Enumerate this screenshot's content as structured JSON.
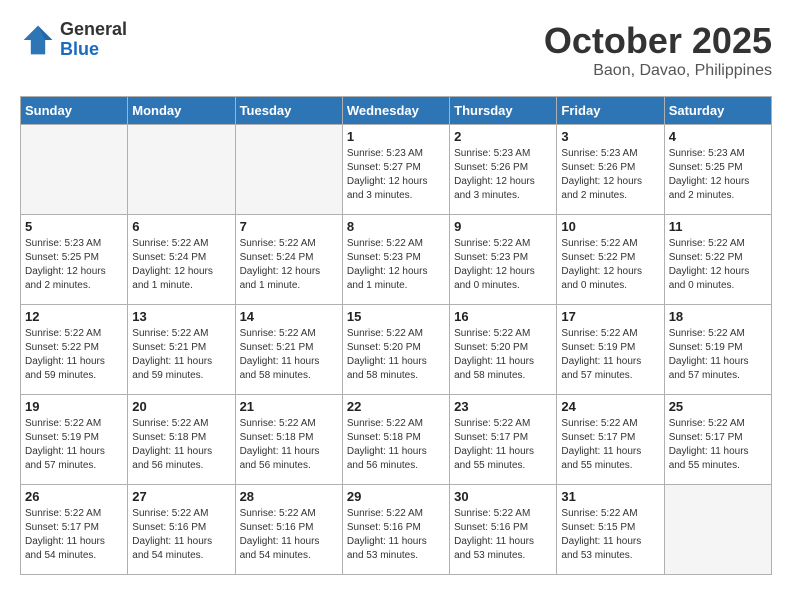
{
  "logo": {
    "general": "General",
    "blue": "Blue"
  },
  "title": "October 2025",
  "location": "Baon, Davao, Philippines",
  "weekdays": [
    "Sunday",
    "Monday",
    "Tuesday",
    "Wednesday",
    "Thursday",
    "Friday",
    "Saturday"
  ],
  "weeks": [
    [
      {
        "day": "",
        "empty": true
      },
      {
        "day": "",
        "empty": true
      },
      {
        "day": "",
        "empty": true
      },
      {
        "day": "1",
        "sunrise": "Sunrise: 5:23 AM",
        "sunset": "Sunset: 5:27 PM",
        "daylight": "Daylight: 12 hours and 3 minutes."
      },
      {
        "day": "2",
        "sunrise": "Sunrise: 5:23 AM",
        "sunset": "Sunset: 5:26 PM",
        "daylight": "Daylight: 12 hours and 3 minutes."
      },
      {
        "day": "3",
        "sunrise": "Sunrise: 5:23 AM",
        "sunset": "Sunset: 5:26 PM",
        "daylight": "Daylight: 12 hours and 2 minutes."
      },
      {
        "day": "4",
        "sunrise": "Sunrise: 5:23 AM",
        "sunset": "Sunset: 5:25 PM",
        "daylight": "Daylight: 12 hours and 2 minutes."
      }
    ],
    [
      {
        "day": "5",
        "sunrise": "Sunrise: 5:23 AM",
        "sunset": "Sunset: 5:25 PM",
        "daylight": "Daylight: 12 hours and 2 minutes."
      },
      {
        "day": "6",
        "sunrise": "Sunrise: 5:22 AM",
        "sunset": "Sunset: 5:24 PM",
        "daylight": "Daylight: 12 hours and 1 minute."
      },
      {
        "day": "7",
        "sunrise": "Sunrise: 5:22 AM",
        "sunset": "Sunset: 5:24 PM",
        "daylight": "Daylight: 12 hours and 1 minute."
      },
      {
        "day": "8",
        "sunrise": "Sunrise: 5:22 AM",
        "sunset": "Sunset: 5:23 PM",
        "daylight": "Daylight: 12 hours and 1 minute."
      },
      {
        "day": "9",
        "sunrise": "Sunrise: 5:22 AM",
        "sunset": "Sunset: 5:23 PM",
        "daylight": "Daylight: 12 hours and 0 minutes."
      },
      {
        "day": "10",
        "sunrise": "Sunrise: 5:22 AM",
        "sunset": "Sunset: 5:22 PM",
        "daylight": "Daylight: 12 hours and 0 minutes."
      },
      {
        "day": "11",
        "sunrise": "Sunrise: 5:22 AM",
        "sunset": "Sunset: 5:22 PM",
        "daylight": "Daylight: 12 hours and 0 minutes."
      }
    ],
    [
      {
        "day": "12",
        "sunrise": "Sunrise: 5:22 AM",
        "sunset": "Sunset: 5:22 PM",
        "daylight": "Daylight: 11 hours and 59 minutes."
      },
      {
        "day": "13",
        "sunrise": "Sunrise: 5:22 AM",
        "sunset": "Sunset: 5:21 PM",
        "daylight": "Daylight: 11 hours and 59 minutes."
      },
      {
        "day": "14",
        "sunrise": "Sunrise: 5:22 AM",
        "sunset": "Sunset: 5:21 PM",
        "daylight": "Daylight: 11 hours and 58 minutes."
      },
      {
        "day": "15",
        "sunrise": "Sunrise: 5:22 AM",
        "sunset": "Sunset: 5:20 PM",
        "daylight": "Daylight: 11 hours and 58 minutes."
      },
      {
        "day": "16",
        "sunrise": "Sunrise: 5:22 AM",
        "sunset": "Sunset: 5:20 PM",
        "daylight": "Daylight: 11 hours and 58 minutes."
      },
      {
        "day": "17",
        "sunrise": "Sunrise: 5:22 AM",
        "sunset": "Sunset: 5:19 PM",
        "daylight": "Daylight: 11 hours and 57 minutes."
      },
      {
        "day": "18",
        "sunrise": "Sunrise: 5:22 AM",
        "sunset": "Sunset: 5:19 PM",
        "daylight": "Daylight: 11 hours and 57 minutes."
      }
    ],
    [
      {
        "day": "19",
        "sunrise": "Sunrise: 5:22 AM",
        "sunset": "Sunset: 5:19 PM",
        "daylight": "Daylight: 11 hours and 57 minutes."
      },
      {
        "day": "20",
        "sunrise": "Sunrise: 5:22 AM",
        "sunset": "Sunset: 5:18 PM",
        "daylight": "Daylight: 11 hours and 56 minutes."
      },
      {
        "day": "21",
        "sunrise": "Sunrise: 5:22 AM",
        "sunset": "Sunset: 5:18 PM",
        "daylight": "Daylight: 11 hours and 56 minutes."
      },
      {
        "day": "22",
        "sunrise": "Sunrise: 5:22 AM",
        "sunset": "Sunset: 5:18 PM",
        "daylight": "Daylight: 11 hours and 56 minutes."
      },
      {
        "day": "23",
        "sunrise": "Sunrise: 5:22 AM",
        "sunset": "Sunset: 5:17 PM",
        "daylight": "Daylight: 11 hours and 55 minutes."
      },
      {
        "day": "24",
        "sunrise": "Sunrise: 5:22 AM",
        "sunset": "Sunset: 5:17 PM",
        "daylight": "Daylight: 11 hours and 55 minutes."
      },
      {
        "day": "25",
        "sunrise": "Sunrise: 5:22 AM",
        "sunset": "Sunset: 5:17 PM",
        "daylight": "Daylight: 11 hours and 55 minutes."
      }
    ],
    [
      {
        "day": "26",
        "sunrise": "Sunrise: 5:22 AM",
        "sunset": "Sunset: 5:17 PM",
        "daylight": "Daylight: 11 hours and 54 minutes."
      },
      {
        "day": "27",
        "sunrise": "Sunrise: 5:22 AM",
        "sunset": "Sunset: 5:16 PM",
        "daylight": "Daylight: 11 hours and 54 minutes."
      },
      {
        "day": "28",
        "sunrise": "Sunrise: 5:22 AM",
        "sunset": "Sunset: 5:16 PM",
        "daylight": "Daylight: 11 hours and 54 minutes."
      },
      {
        "day": "29",
        "sunrise": "Sunrise: 5:22 AM",
        "sunset": "Sunset: 5:16 PM",
        "daylight": "Daylight: 11 hours and 53 minutes."
      },
      {
        "day": "30",
        "sunrise": "Sunrise: 5:22 AM",
        "sunset": "Sunset: 5:16 PM",
        "daylight": "Daylight: 11 hours and 53 minutes."
      },
      {
        "day": "31",
        "sunrise": "Sunrise: 5:22 AM",
        "sunset": "Sunset: 5:15 PM",
        "daylight": "Daylight: 11 hours and 53 minutes."
      },
      {
        "day": "",
        "empty": true
      }
    ]
  ]
}
